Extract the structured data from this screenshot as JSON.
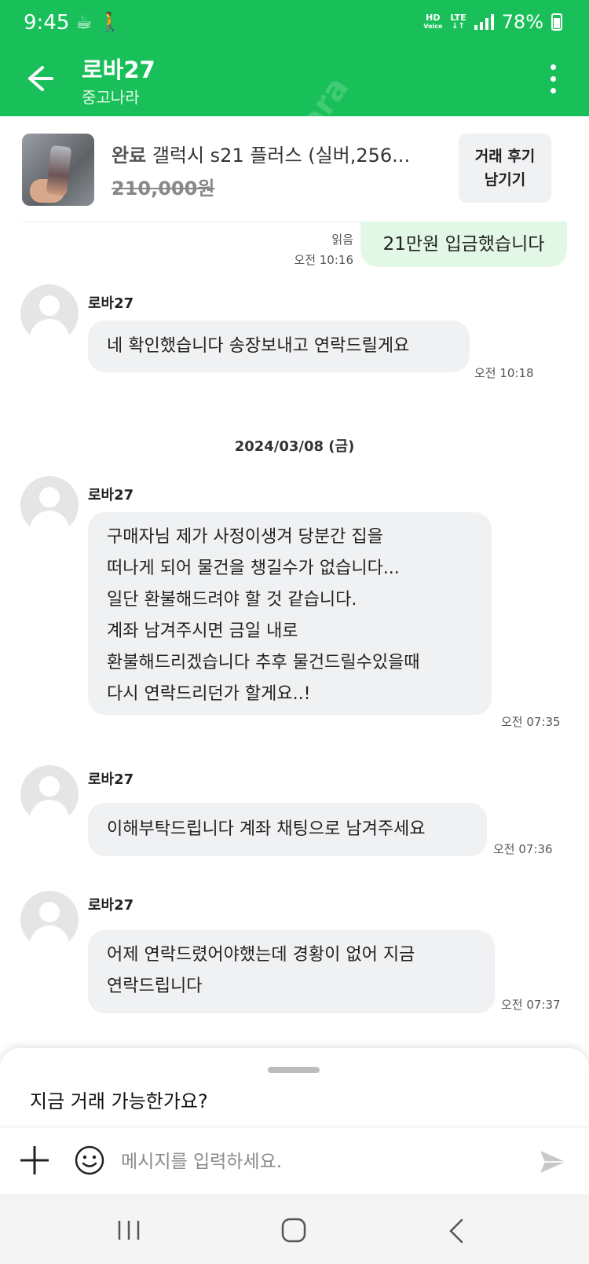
{
  "status_bar": {
    "time": "9:45",
    "left_icons": [
      "coffee-cup-icon",
      "walking-icon"
    ],
    "hd_top": "HD",
    "hd_bottom": "Voice",
    "lte": "LTE",
    "battery": "78%"
  },
  "header": {
    "title": "로바27",
    "subtitle": "중고나라",
    "watermark": "joonara"
  },
  "product": {
    "status": "완료",
    "title": "갤럭시 s21 플러스 (실버,256...",
    "price": "210,000원",
    "review_button_line1": "거래 후기",
    "review_button_line2": "남기기"
  },
  "messages": {
    "m1": {
      "read": "읽음",
      "time": "오전 10:16",
      "text": "21만원 입금했습니다"
    },
    "m2": {
      "sender": "로바27",
      "text": "네 확인했습니다 송장보내고 연락드릴게요",
      "time": "오전 10:18"
    },
    "date": "2024/03/08 (금)",
    "m3": {
      "sender": "로바27",
      "lines": [
        "구매자님 제가 사정이생겨 당분간 집을",
        "떠나게 되어 물건을 챙길수가 없습니다...",
        "일단 환불해드려야 할 것 같습니다.",
        "계좌 남겨주시면 금일 내로",
        "환불해드리겠습니다 추후 물건드릴수있을때",
        "다시 연락드리던가 할게요..!"
      ],
      "time": "오전 07:35"
    },
    "m4": {
      "sender": "로바27",
      "text": "이해부탁드립니다 계좌 채팅으로 남겨주세요",
      "time": "오전 07:36"
    },
    "m5": {
      "sender": "로바27",
      "lines": [
        "어제 연락드렸어야했는데 경황이 없어 지금",
        "연락드립니다"
      ],
      "time": "오전 07:37"
    }
  },
  "suggestion": "지금 거래 가능한가요?",
  "input": {
    "placeholder": "메시지를 입력하세요."
  },
  "colors": {
    "brand": "#19c05a",
    "my_bubble": "#e2f7e5",
    "their_bubble": "#f0f1f3"
  }
}
